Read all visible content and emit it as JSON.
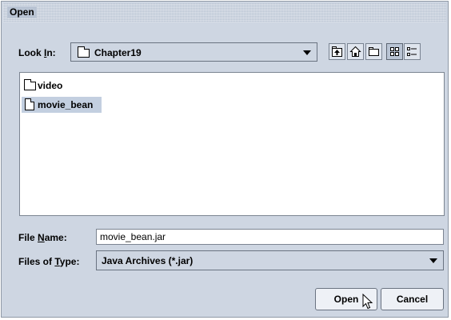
{
  "window": {
    "title": "Open"
  },
  "look_in": {
    "label_prefix": "Look ",
    "label_mnemonic": "I",
    "label_suffix": "n:",
    "value": "Chapter19"
  },
  "toolbar": {
    "buttons": [
      {
        "name": "up-one-level-icon"
      },
      {
        "name": "home-icon"
      },
      {
        "name": "new-folder-icon"
      },
      {
        "name": "list-view-icon",
        "selected": true
      },
      {
        "name": "details-view-icon"
      }
    ]
  },
  "files": [
    {
      "name": "video",
      "type": "folder",
      "selected": false
    },
    {
      "name": "movie_bean",
      "type": "file",
      "selected": true
    }
  ],
  "file_name": {
    "label_prefix": "File ",
    "label_mnemonic": "N",
    "label_suffix": "ame:",
    "value": "movie_bean.jar"
  },
  "files_of_type": {
    "label_prefix": "Files of ",
    "label_mnemonic": "T",
    "label_suffix": "ype:",
    "value": "Java Archives (*.jar)"
  },
  "buttons": {
    "open": "Open",
    "cancel": "Cancel"
  },
  "colors": {
    "dialog_bg": "#ced6e2",
    "selection": "#c3cfe0"
  }
}
